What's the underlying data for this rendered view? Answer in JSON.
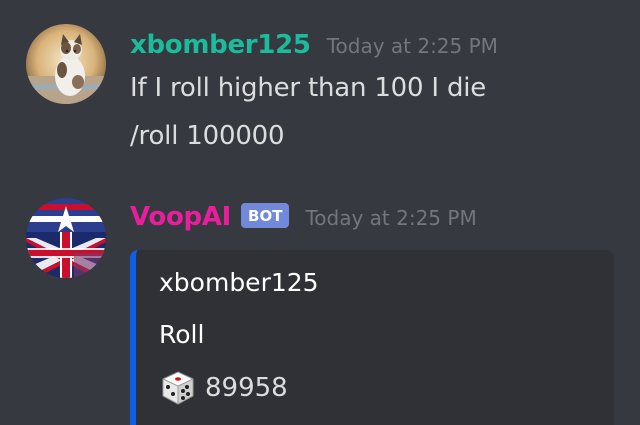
{
  "messages": [
    {
      "username": "xbomber125",
      "username_color": "#1abc9c",
      "timestamp": "Today at 2:25 PM",
      "lines": [
        "If I roll higher than 100 I die",
        "/roll 100000"
      ]
    },
    {
      "username": "VoopAI",
      "username_color": "#e91e9c",
      "bot_tag": "BOT",
      "timestamp": "Today at 2:25 PM",
      "embed": {
        "accent_color": "#0d5ee8",
        "author": "xbomber125",
        "field_name": "Roll",
        "field_icon": "dice-icon",
        "field_value": "89958"
      }
    }
  ],
  "colors": {
    "background": "#36393f",
    "embed_background": "#2f3136",
    "timestamp": "#72767d",
    "bot_tag": "#7289da"
  }
}
